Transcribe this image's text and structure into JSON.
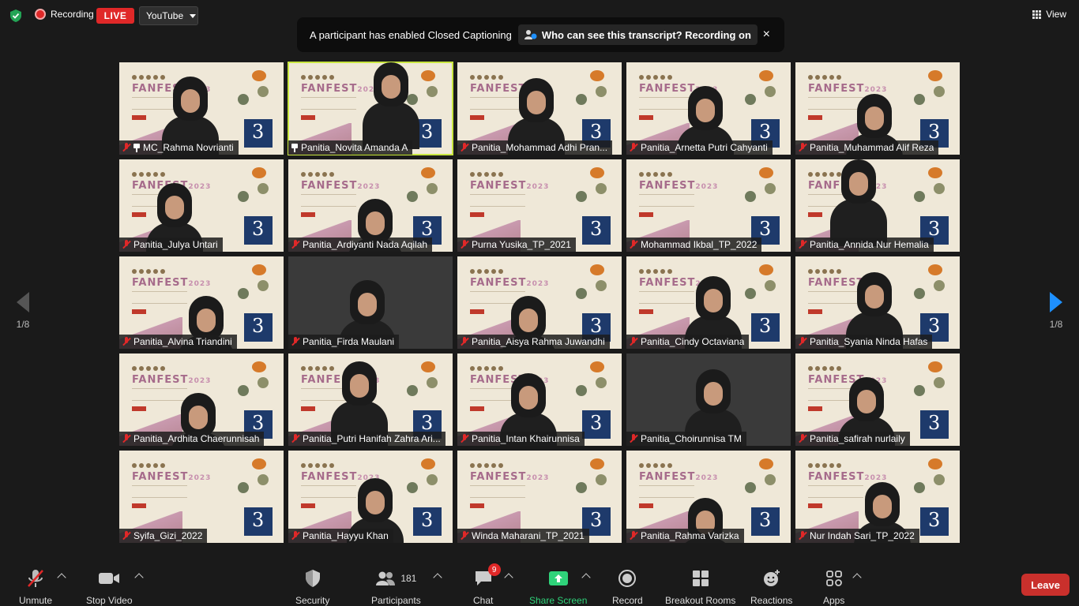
{
  "top": {
    "recording_label": "Recording",
    "live_label": "LIVE",
    "stream_target": "YouTube",
    "view_label": "View"
  },
  "notice": {
    "message": "A participant has enabled Closed Captioning",
    "link": "Who can see this transcript? Recording on",
    "close": "×"
  },
  "pager": {
    "page": "1/8"
  },
  "participants": [
    {
      "name": "MC_Rahma Novrianti",
      "muted": true,
      "pinned": true
    },
    {
      "name": "Panitia_Novita Amanda A",
      "muted": false,
      "pinned": true
    },
    {
      "name": "Panitia_Mohammad Adhi Pran...",
      "muted": true,
      "pinned": false
    },
    {
      "name": "Panitia_Arnetta Putri Cahyanti",
      "muted": true,
      "pinned": false
    },
    {
      "name": "Panitia_Muhammad Alif Reza",
      "muted": true,
      "pinned": false
    },
    {
      "name": "Panitia_Julya Untari",
      "muted": true,
      "pinned": false
    },
    {
      "name": "Panitia_Ardiyanti Nada Aqilah",
      "muted": true,
      "pinned": false
    },
    {
      "name": "Purna Yusika_TP_2021",
      "muted": true,
      "pinned": false
    },
    {
      "name": "Mohammad Ikbal_TP_2022",
      "muted": true,
      "pinned": false
    },
    {
      "name": "Panitia_Annida Nur Hemalia",
      "muted": true,
      "pinned": false
    },
    {
      "name": "Panitia_Alvina Triandini",
      "muted": true,
      "pinned": false
    },
    {
      "name": "Panitia_Firda Maulani",
      "muted": true,
      "pinned": false
    },
    {
      "name": "Panitia_Aisya Rahma Juwandhi",
      "muted": true,
      "pinned": false
    },
    {
      "name": "Panitia_Cindy Octaviana",
      "muted": true,
      "pinned": false
    },
    {
      "name": "Panitia_Syania Ninda Hafas",
      "muted": true,
      "pinned": false
    },
    {
      "name": "Panitia_Ardhita Chaerunnisah",
      "muted": true,
      "pinned": false
    },
    {
      "name": "Panitia_Putri Hanifah Zahra Ari...",
      "muted": true,
      "pinned": false
    },
    {
      "name": "Panitia_Intan Khairunnisa",
      "muted": true,
      "pinned": false
    },
    {
      "name": "Panitia_Choirunnisa TM",
      "muted": true,
      "pinned": false
    },
    {
      "name": "Panitia_safirah nurlaily",
      "muted": true,
      "pinned": false
    },
    {
      "name": "Syifa_Gizi_2022",
      "muted": true,
      "pinned": false
    },
    {
      "name": "Panitia_Hayyu Khan",
      "muted": true,
      "pinned": false
    },
    {
      "name": "Winda Maharani_TP_2021",
      "muted": true,
      "pinned": false
    },
    {
      "name": "Panitia_Rahma Varizka",
      "muted": true,
      "pinned": false
    },
    {
      "name": "Nur Indah Sari_TP_2022",
      "muted": true,
      "pinned": false
    }
  ],
  "background_banner": {
    "title": "FANFEST",
    "year": "2023"
  },
  "toolbar": {
    "unmute": "Unmute",
    "stop_video": "Stop Video",
    "security": "Security",
    "participants": "Participants",
    "participant_count": "181",
    "chat": "Chat",
    "chat_badge": "9",
    "share_screen": "Share Screen",
    "record": "Record",
    "breakout_rooms": "Breakout Rooms",
    "reactions": "Reactions",
    "apps": "Apps",
    "leave": "Leave"
  },
  "colors": {
    "live_red": "#e02828",
    "share_green": "#2fd37a",
    "active_speaker": "#c9e640",
    "leave_red": "#c9302c",
    "pager_blue": "#1e90ff"
  }
}
